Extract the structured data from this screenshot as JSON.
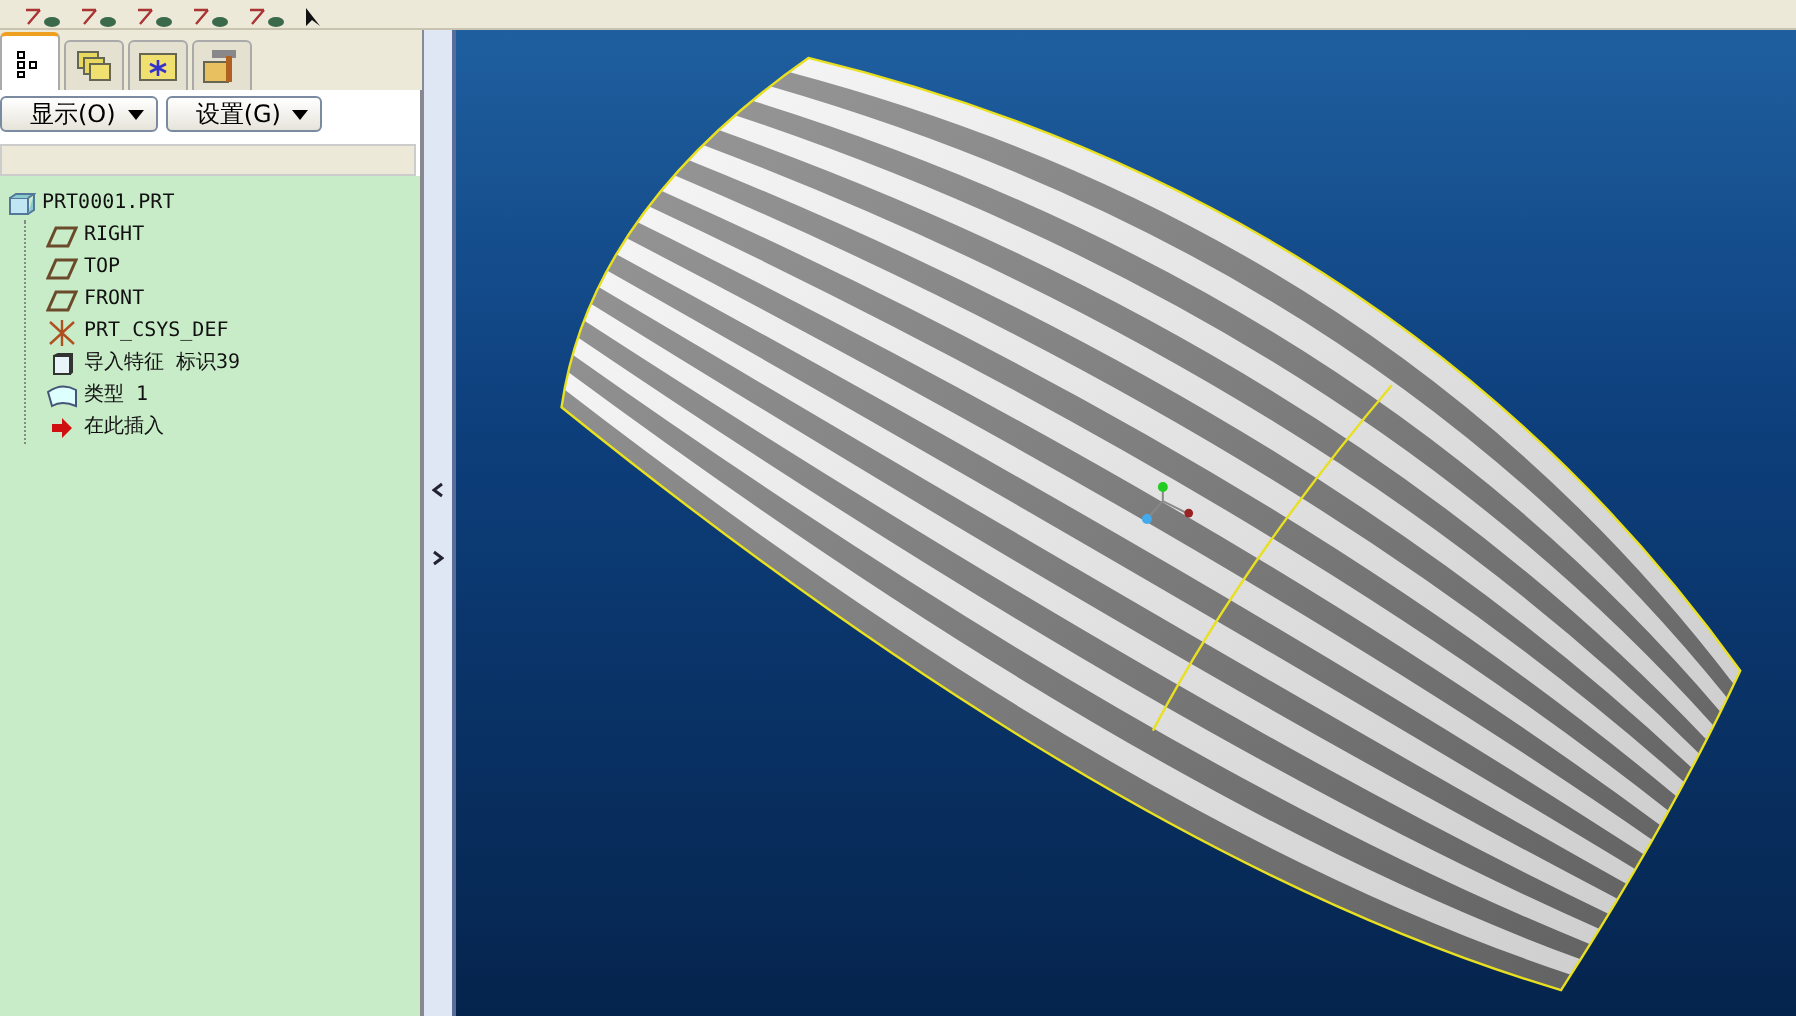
{
  "navigator_tabs": [
    {
      "kind": "tree",
      "selected": true
    },
    {
      "kind": "folders",
      "selected": false
    },
    {
      "kind": "favorites",
      "selected": false
    },
    {
      "kind": "tools",
      "selected": false
    }
  ],
  "menus": [
    {
      "label": "显示(O)"
    },
    {
      "label": "设置(G)"
    }
  ],
  "model_tree": {
    "root": {
      "label": "PRT0001.PRT",
      "kind": "part",
      "children": [
        {
          "label": "RIGHT",
          "kind": "plane"
        },
        {
          "label": "TOP",
          "kind": "plane"
        },
        {
          "label": "FRONT",
          "kind": "plane"
        },
        {
          "label": "PRT_CSYS_DEF",
          "kind": "csys"
        },
        {
          "label": "导入特征 标识39",
          "kind": "import"
        },
        {
          "label": "类型 1",
          "kind": "quilt"
        },
        {
          "label": "在此插入",
          "kind": "insert"
        }
      ]
    }
  }
}
